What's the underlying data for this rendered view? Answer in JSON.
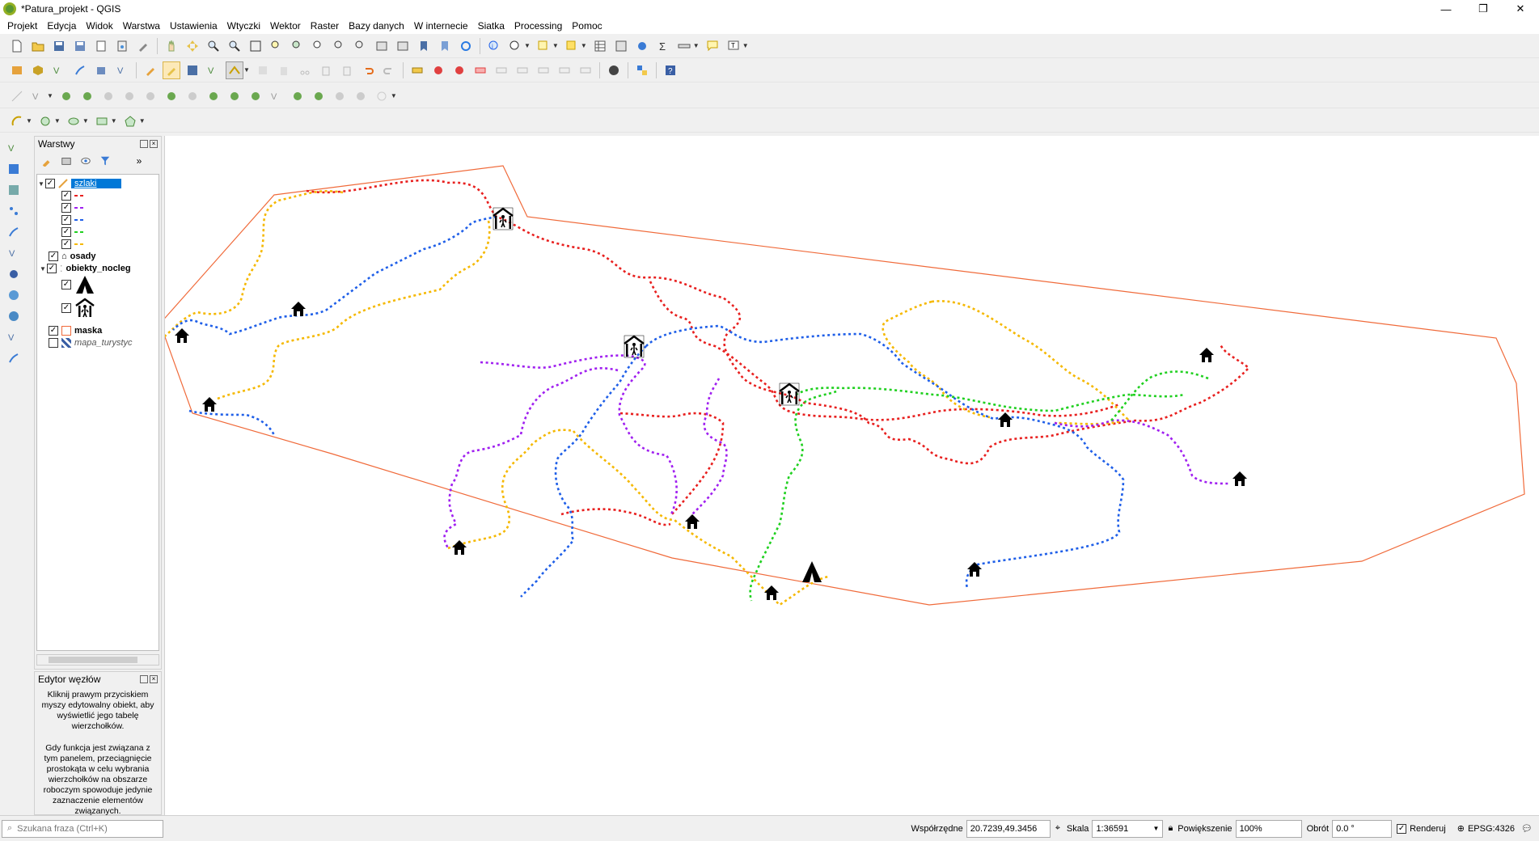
{
  "window": {
    "title": "*Patura_projekt - QGIS",
    "controls": [
      "—",
      "❐",
      "✕"
    ]
  },
  "menu": [
    "Projekt",
    "Edycja",
    "Widok",
    "Warstwa",
    "Ustawienia",
    "Wtyczki",
    "Wektor",
    "Raster",
    "Bazy danych",
    "W internecie",
    "Siatka",
    "Processing",
    "Pomoc"
  ],
  "layers_panel": {
    "title": "Warstwy",
    "more": "»",
    "layers": [
      {
        "name": "szlaki",
        "checked": true,
        "selected": true,
        "children": [
          {
            "color": "#e8201f"
          },
          {
            "color": "#a020f0"
          },
          {
            "color": "#1f5fe8"
          },
          {
            "color": "#20d020"
          },
          {
            "color": "#f5b800"
          }
        ]
      },
      {
        "name": "osady",
        "checked": true
      },
      {
        "name": "obiekty_nocleg",
        "checked": true
      },
      {
        "name": "maska",
        "checked": true
      },
      {
        "name": "mapa_turystyc",
        "checked": false
      }
    ]
  },
  "node_editor": {
    "title": "Edytor węzłów",
    "text1": "Kliknij prawym przyciskiem myszy edytowalny obiekt, aby wyświetlić jego tabelę wierzchołków.",
    "text2": "Gdy funkcja jest związana z tym panelem, przeciągnięcie prostokąta w celu wybrania wierzchołków na obszarze roboczym spowoduje jedynie zaznaczenie elementów związanych."
  },
  "statusbar": {
    "search_placeholder": "Szukana fraza (Ctrl+K)",
    "coord_label": "Współrzędne",
    "coord_value": "20.7239,49.3456",
    "scale_label": "Skala",
    "scale_value": "1:36591",
    "zoom_label": "Powiększenie",
    "zoom_value": "100%",
    "rotation_label": "Obrót",
    "rotation_value": "0.0 °",
    "render_label": "Renderuj",
    "crs": "EPSG:4326"
  },
  "map_colors": {
    "red": "#e8201f",
    "purple": "#a020f0",
    "blue": "#1f5fe8",
    "green": "#20d020",
    "yellow": "#f5b800",
    "mask": "#f06a3a"
  }
}
